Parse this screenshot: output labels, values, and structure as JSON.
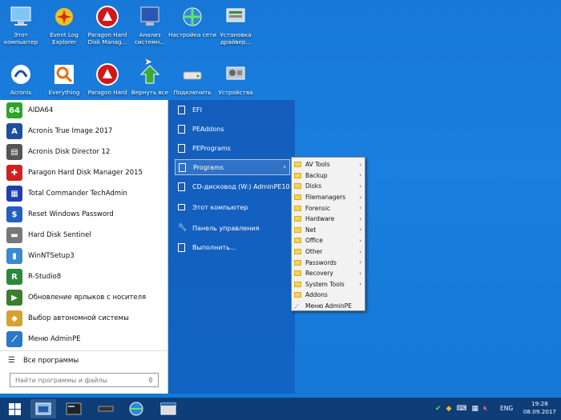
{
  "desktop": {
    "icons": [
      {
        "label": "Этот компьютер",
        "icon": "computer-icon"
      },
      {
        "label": "Event Log Explorer",
        "icon": "event-log-icon"
      },
      {
        "label": "Paragon Hard Disk Manag...",
        "icon": "paragon-icon"
      },
      {
        "label": "Анализ системн...",
        "icon": "monitor-icon"
      },
      {
        "label": "Настройка сети",
        "icon": "network-icon"
      },
      {
        "label": "Установка драйвер...",
        "icon": "driver-icon"
      },
      {
        "label": "Acronis",
        "icon": "acronis-icon"
      },
      {
        "label": "Everything",
        "icon": "search-icon"
      },
      {
        "label": "Paragon Hard",
        "icon": "paragon-icon"
      },
      {
        "label": "Вернуть все",
        "icon": "restore-icon"
      },
      {
        "label": "Подключить",
        "icon": "drive-icon"
      },
      {
        "label": "Устройства",
        "icon": "devices-icon"
      }
    ]
  },
  "start_menu": {
    "programs": [
      {
        "label": "AIDA64",
        "icon": "aida64-icon",
        "badge": "64",
        "color": "#2aa52a"
      },
      {
        "label": "Acronis True Image 2017",
        "icon": "acronis-true-image-icon",
        "badge": "A",
        "color": "#1c4fa0"
      },
      {
        "label": "Acronis Disk Director 12",
        "icon": "acronis-disk-director-icon",
        "badge": "▤",
        "color": "#555555"
      },
      {
        "label": "Paragon Hard Disk Manager 2015",
        "icon": "paragon-icon",
        "badge": "✚",
        "color": "#d02020"
      },
      {
        "label": "Total Commander TechAdmin",
        "icon": "total-commander-icon",
        "badge": "▦",
        "color": "#1f3fb0"
      },
      {
        "label": "Reset Windows Password",
        "icon": "reset-password-icon",
        "badge": "$",
        "color": "#2060c0"
      },
      {
        "label": "Hard Disk Sentinel",
        "icon": "hard-disk-sentinel-icon",
        "badge": "▬",
        "color": "#777777"
      },
      {
        "label": "WinNTSetup3",
        "icon": "winntsetup-icon",
        "badge": "▮",
        "color": "#3a8ad0"
      },
      {
        "label": "R-Studio8",
        "icon": "r-studio-icon",
        "badge": "R",
        "color": "#2a8a3a"
      },
      {
        "label": "Обновление ярлыков с носителя",
        "icon": "update-shortcuts-icon",
        "badge": "▶",
        "color": "#3d7d2d"
      },
      {
        "label": "Выбор автономной системы",
        "icon": "offline-system-icon",
        "badge": "◆",
        "color": "#d8a030"
      },
      {
        "label": "Меню AdminPE",
        "icon": "adminpe-menu-icon",
        "badge": "⟋",
        "color": "#2a78c8"
      }
    ],
    "all_programs_label": "Все программы",
    "search_placeholder": "Найти программы и файлы",
    "right_items": [
      {
        "label": "EFI"
      },
      {
        "label": "PEAddons"
      },
      {
        "label": "PEPrograms"
      },
      {
        "label": "Programs"
      },
      {
        "label": "CD-дисковод (W:) AdminPE10"
      },
      {
        "label": "Этот компьютер"
      },
      {
        "label": "Панель управления"
      },
      {
        "label": "Выполнить..."
      }
    ]
  },
  "submenu": {
    "items": [
      {
        "label": "AV Tools",
        "has_arrow": true
      },
      {
        "label": "Backup",
        "has_arrow": true
      },
      {
        "label": "Disks",
        "has_arrow": true
      },
      {
        "label": "Filemanagers",
        "has_arrow": true
      },
      {
        "label": "Forensic",
        "has_arrow": true
      },
      {
        "label": "Hardware",
        "has_arrow": true
      },
      {
        "label": "Net",
        "has_arrow": true
      },
      {
        "label": "Office",
        "has_arrow": true
      },
      {
        "label": "Other",
        "has_arrow": true
      },
      {
        "label": "Passwords",
        "has_arrow": true
      },
      {
        "label": "Recovery",
        "has_arrow": true
      },
      {
        "label": "System Tools",
        "has_arrow": true
      },
      {
        "label": "Addons",
        "has_arrow": false
      },
      {
        "label": "Меню AdminPE",
        "has_arrow": false
      }
    ]
  },
  "taskbar": {
    "language": "ENG",
    "time": "19:28",
    "date": "08.09.2017"
  }
}
